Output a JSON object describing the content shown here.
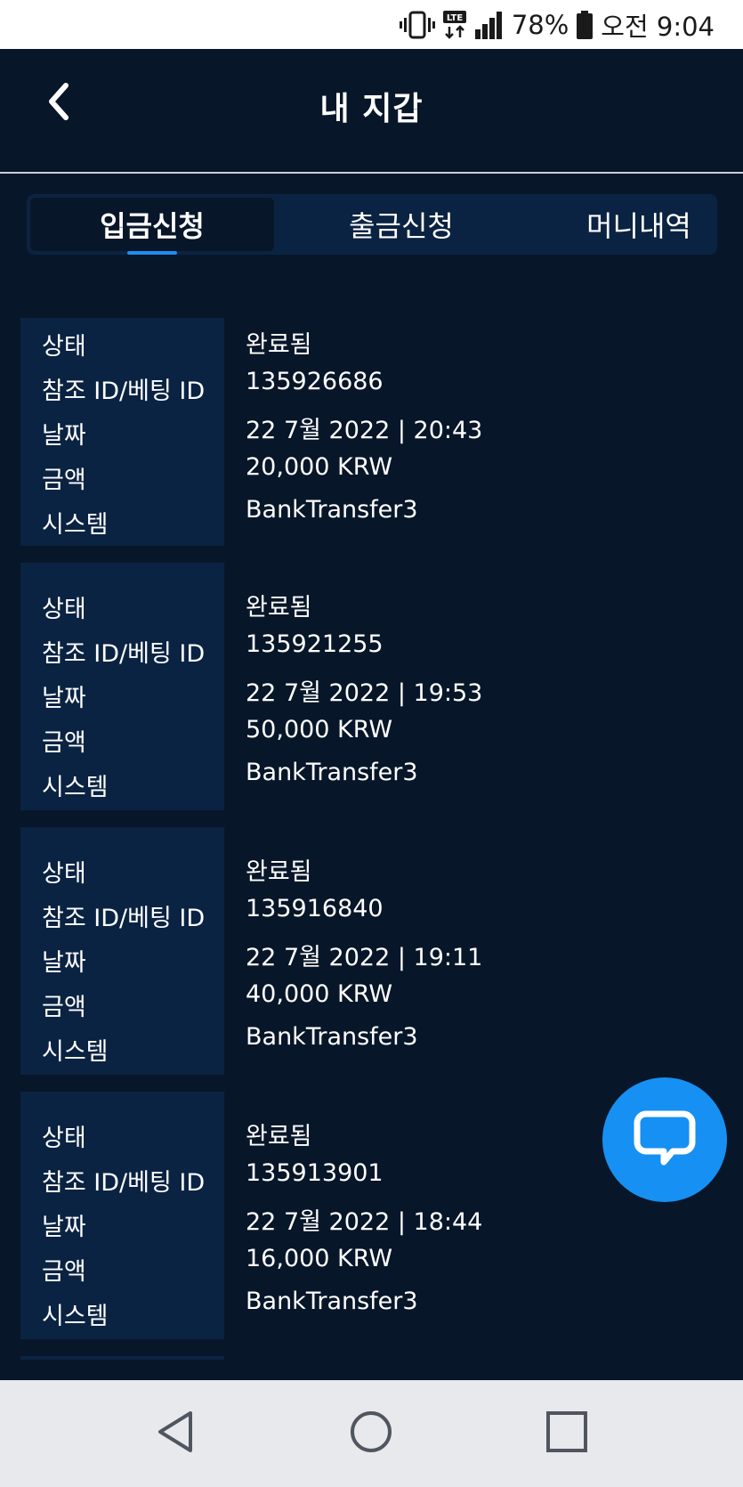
{
  "status_bar": {
    "battery": "78%",
    "time": "오전 9:04",
    "network": "LTE"
  },
  "header": {
    "title": "내 지갑"
  },
  "tabs": [
    {
      "label": "입금신청",
      "active": true
    },
    {
      "label": "출금신청",
      "active": false
    },
    {
      "label": "머니내역",
      "active": false
    }
  ],
  "labels": {
    "status": "상태",
    "ref_id": "참조 ID/베팅 ID",
    "date": "날짜",
    "amount": "금액",
    "system": "시스템"
  },
  "transactions": [
    {
      "status": "완료됨",
      "ref_id": "135926686",
      "date": "22 7월 2022 | 20:43",
      "amount": "20,000 KRW",
      "system": "BankTransfer3"
    },
    {
      "status": "완료됨",
      "ref_id": "135921255",
      "date": "22 7월 2022 | 19:53",
      "amount": "50,000 KRW",
      "system": "BankTransfer3"
    },
    {
      "status": "완료됨",
      "ref_id": "135916840",
      "date": "22 7월 2022 | 19:11",
      "amount": "40,000 KRW",
      "system": "BankTransfer3"
    },
    {
      "status": "완료됨",
      "ref_id": "135913901",
      "date": "22 7월 2022 | 18:44",
      "amount": "16,000 KRW",
      "system": "BankTransfer3"
    }
  ],
  "colors": {
    "background": "#081629",
    "card_label_bg": "#0b2342",
    "accent": "#1e8ef0",
    "fab": "#1690f3"
  },
  "icons": {
    "back": "chevron-left-icon",
    "chat": "chat-bubble-icon",
    "nav_back": "triangle-back-icon",
    "nav_home": "circle-home-icon",
    "nav_recents": "square-recents-icon"
  }
}
